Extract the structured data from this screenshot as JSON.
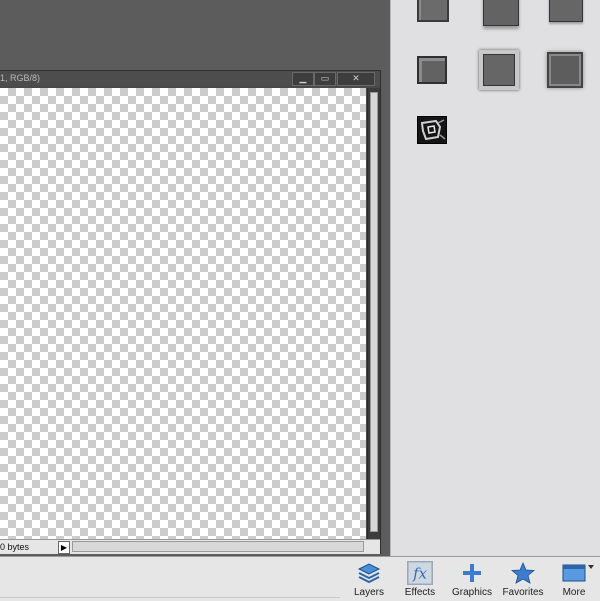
{
  "document": {
    "title_fragment": "1, RGB/8)",
    "min_glyph": "▁",
    "max_glyph": "▭",
    "close_glyph": "✕",
    "status_text": "0 bytes",
    "status_arrow": "▶"
  },
  "effects_panel": {
    "swatches": [
      "bevel-style-1",
      "bevel-style-2",
      "bevel-style-3",
      "bevel-style-4",
      "bevel-style-5",
      "bevel-style-6",
      "chrome-style"
    ]
  },
  "toolbar": {
    "items": [
      {
        "label": "Layers",
        "icon": "layers-icon"
      },
      {
        "label": "Effects",
        "icon": "fx-icon"
      },
      {
        "label": "Graphics",
        "icon": "plus-icon"
      },
      {
        "label": "Favorites",
        "icon": "star-icon"
      },
      {
        "label": "More",
        "icon": "window-icon"
      }
    ]
  },
  "colors": {
    "accent": "#3c78c8",
    "panel": "#e0e0e2",
    "workspace": "#5c5c5c"
  }
}
